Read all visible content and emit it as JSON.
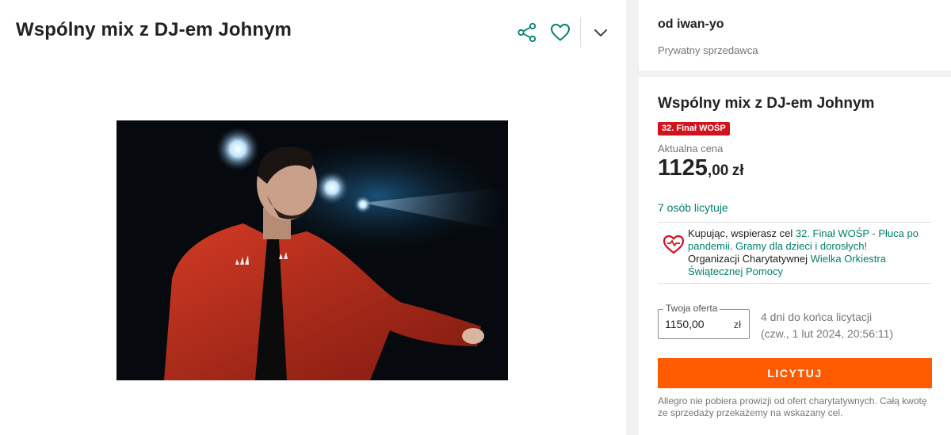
{
  "listing": {
    "title": "Wspólny mix z DJ-em Johnym"
  },
  "actions": {
    "share_icon": "share-icon",
    "favorite_icon": "heart-icon",
    "expand_icon": "chevron-down-icon"
  },
  "seller": {
    "name": "od iwan-yo",
    "type": "Prywatny sprzedawca"
  },
  "offer": {
    "title": "Wspólny mix z DJ-em Johnym",
    "badge": "32. Finał WOŚP",
    "price_label": "Aktualna cena",
    "price_whole": "1125",
    "price_fraction": ",00",
    "price_currency": "zł",
    "bidders": "7 osób licytuje",
    "charity_prefix": "Kupując, wspierasz cel ",
    "charity_goal": "32. Finał WOŚP - Płuca po pandemii. Gramy dla dzieci i dorosłych!",
    "charity_org_prefix": "Organizacji Charytatywnej ",
    "charity_org": "Wielka Orkiestra Świątecznej Pomocy",
    "bid_legend": "Twoja oferta",
    "bid_value": "1150,00",
    "bid_unit": "zł",
    "time_left": "4 dni do końca licytacji",
    "end_date": "(czw., 1 lut 2024, 20:56:11)",
    "bid_button": "LICYTUJ",
    "note": "Allegro nie pobiera prowizji od ofert charytatywnych. Całą kwotę ze sprzedaży przekażemy na wskazany cel."
  },
  "colors": {
    "accent_teal": "#00806e",
    "cta_orange": "#ff5a00",
    "badge_red": "#d1131e",
    "charity_heart": "#d1131e"
  }
}
